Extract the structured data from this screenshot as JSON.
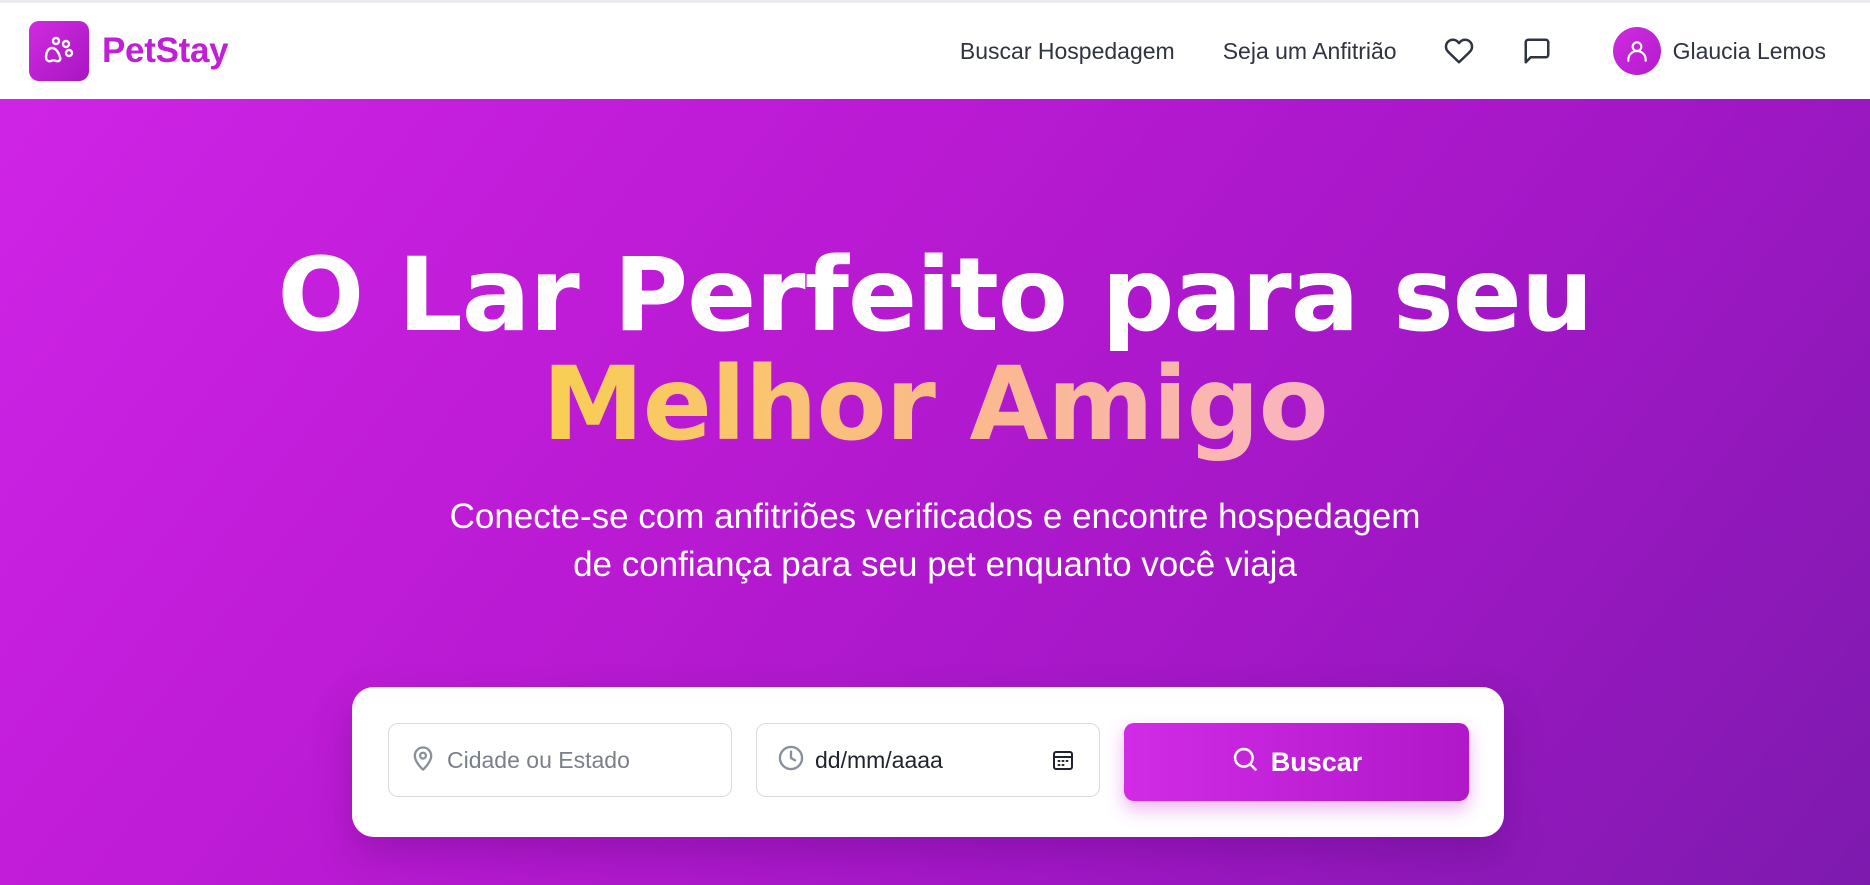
{
  "nav": {
    "brand": "PetStay",
    "links": [
      "Buscar Hospedagem",
      "Seja um Anfitrião"
    ],
    "user_name": "Glaucia Lemos",
    "icons": [
      "paw-icon",
      "heart-icon",
      "message-icon",
      "user-icon"
    ]
  },
  "hero": {
    "title_line1": "O Lar Perfeito para seu",
    "title_line2": "Melhor Amigo",
    "subtitle": "Conecte-se com anfitriões verificados e encontre hospedagem de confiança para seu pet enquanto você viaja"
  },
  "search": {
    "location_placeholder": "Cidade ou Estado",
    "date_value": "dd/mm/aaaa",
    "button_label": "Buscar"
  },
  "colors": {
    "brand": "#c01fd6",
    "hero_start": "#cf24e6",
    "hero_end": "#7d1aae",
    "highlight_start": "#f8cf52",
    "highlight_end": "#f9b4c1"
  }
}
